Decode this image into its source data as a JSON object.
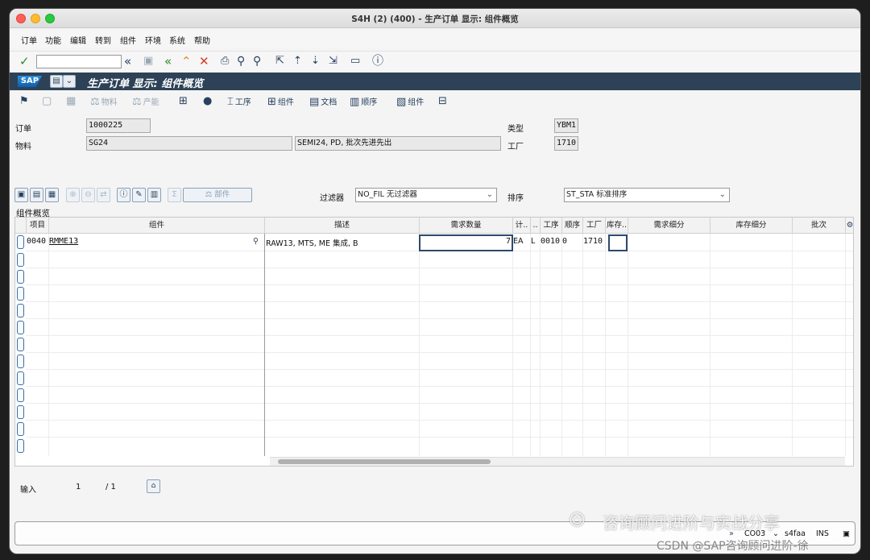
{
  "window": {
    "title": "S4H (2) (400) - 生产订单 显示: 组件概览"
  },
  "menu": [
    "订单",
    "功能",
    "编辑",
    "转到",
    "组件",
    "环境",
    "系统",
    "帮助"
  ],
  "sap": {
    "logo": "SAP",
    "screen_title": "生产订单 显示: 组件概览"
  },
  "app_toolbar": {
    "material": "物料",
    "capacity": "产能",
    "operation": "工序",
    "component_group": "组件",
    "document": "文档",
    "sequence": "顺序",
    "component": "组件"
  },
  "header": {
    "order_label": "订单",
    "order_value": "1000225",
    "material_label": "物料",
    "material_value": "SG24",
    "material_desc": "SEMI24, PD, 批次先进先出",
    "type_label": "类型",
    "type_value": "YBM1",
    "plant_label": "工厂",
    "plant_value": "1710"
  },
  "filters": {
    "part_button": "部件",
    "filter_label": "过滤器",
    "filter_value": "NO_FIL 无过滤器",
    "sort_label": "排序",
    "sort_value": "ST_STA 标准排序"
  },
  "grid": {
    "caption": "组件概览",
    "columns": [
      "项目",
      "组件",
      "描述",
      "需求数量",
      "计..",
      "..",
      "工序",
      "顺序",
      "工厂",
      "库存..",
      "需求细分",
      "库存细分",
      "批次"
    ],
    "row": {
      "item": "0040",
      "component": "RMME13",
      "desc": "RAW13, MTS, ME 集成, B",
      "qty": "7",
      "unit": "EA",
      "cat": "L",
      "op": "0010",
      "seq": "0",
      "plant": "1710"
    }
  },
  "footer": {
    "entry_label": "输入",
    "entry_current": "1",
    "entry_total": "/ 1"
  },
  "status": {
    "tcode": "CO03",
    "server": "s4faa",
    "mode": "INS"
  },
  "watermark": {
    "line1": "咨询顾问进阶与实战分享",
    "line2": "CSDN @SAP咨询顾问进阶-徐"
  }
}
